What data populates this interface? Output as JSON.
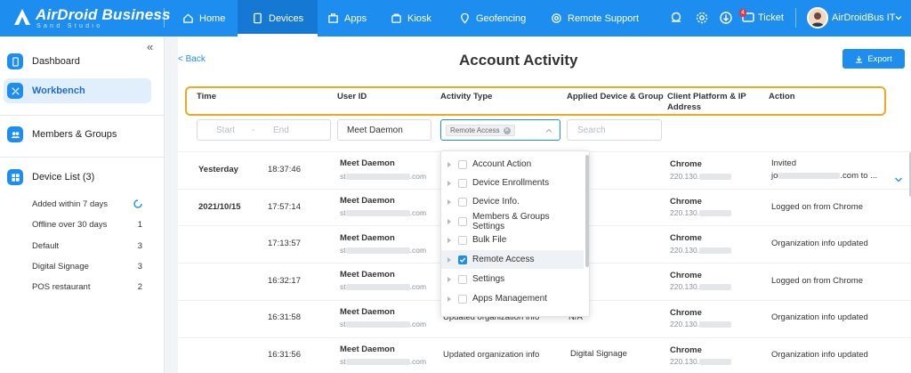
{
  "brand": {
    "name": "AirDroid Business",
    "sub": "Sand Studio"
  },
  "nav": [
    {
      "label": "Home",
      "icon": "home-icon"
    },
    {
      "label": "Devices",
      "icon": "devices-icon",
      "active": true
    },
    {
      "label": "Apps",
      "icon": "apps-icon"
    },
    {
      "label": "Kiosk",
      "icon": "kiosk-icon"
    },
    {
      "label": "Geofencing",
      "icon": "geofencing-icon"
    },
    {
      "label": "Remote Support",
      "icon": "remote-support-icon"
    }
  ],
  "topright": {
    "badge": "4",
    "ticket": "Ticket",
    "user": "AirDroidBus IT"
  },
  "sidebar": {
    "items": [
      {
        "label": "Dashboard",
        "icon": "dashboard-icon"
      },
      {
        "label": "Workbench",
        "icon": "workbench-icon",
        "active": true
      },
      {
        "label": "Members & Groups",
        "icon": "members-icon"
      },
      {
        "label": "Device List (3)",
        "icon": "device-list-icon"
      }
    ],
    "sub": [
      {
        "label": "Added within 7 days",
        "count": ""
      },
      {
        "label": "Offline over 30 days",
        "count": "1"
      },
      {
        "label": "Default",
        "count": "3"
      },
      {
        "label": "Digital Signage",
        "count": "3"
      },
      {
        "label": "POS restaurant",
        "count": "2"
      }
    ]
  },
  "page": {
    "back": "< Back",
    "title": "Account Activity",
    "export": "Export"
  },
  "columns": [
    "Time",
    "User ID",
    "Activity Type",
    "Applied Device & Group",
    "Client Platform & IP Address",
    "Action"
  ],
  "filters": {
    "start": "Start",
    "dash": "-",
    "end": "End",
    "user": "Meet Daemon",
    "activity_tag": "Remote Access",
    "search_placeholder": "Search"
  },
  "rows": [
    {
      "date": "Yesterday",
      "time": "18:37:46",
      "user": "Meet Daemon",
      "email_pre": "st",
      "email_post": ".com",
      "type": "",
      "device": "",
      "platform": "Chrome",
      "ip": "220.130.",
      "action": "Invited",
      "action2_pre": "jo",
      "action2_post": ".com to ..."
    },
    {
      "date": "2021/10/15",
      "time": "17:57:14",
      "user": "Meet Daemon",
      "email_pre": "st",
      "email_post": ".com",
      "type": "",
      "device": "",
      "platform": "Chrome",
      "ip": "220.130.",
      "action": "Logged on from Chrome"
    },
    {
      "date": "",
      "time": "17:13:57",
      "user": "Meet Daemon",
      "email_pre": "st",
      "email_post": ".com",
      "type": "",
      "device": "",
      "platform": "Chrome",
      "ip": "220.130.",
      "action": "Organization info updated"
    },
    {
      "date": "",
      "time": "16:32:17",
      "user": "Meet Daemon",
      "email_pre": "st",
      "email_post": ".com",
      "type": "",
      "device": "",
      "platform": "Chrome",
      "ip": "220.130.",
      "action": "Logged on from Chrome"
    },
    {
      "date": "",
      "time": "16:31:58",
      "user": "Meet Daemon",
      "email_pre": "st",
      "email_post": ".com",
      "type": "Updated organization info",
      "device": "N/A",
      "platform": "Chrome",
      "ip": "220.130.",
      "action": "Organization info updated"
    },
    {
      "date": "",
      "time": "16:31:56",
      "user": "Meet Daemon",
      "email_pre": "st",
      "email_post": ".com",
      "type": "Updated organization info",
      "device": "Digital Signage",
      "platform": "Chrome",
      "ip": "220.130.",
      "action": "Organization info updated"
    }
  ],
  "dropdown": [
    {
      "label": "Account Action",
      "checked": false
    },
    {
      "label": "Device Enrollments",
      "checked": false
    },
    {
      "label": "Device Info.",
      "checked": false
    },
    {
      "label": "Members & Groups Settings",
      "checked": false
    },
    {
      "label": "Bulk File",
      "checked": false
    },
    {
      "label": "Remote Access",
      "checked": true
    },
    {
      "label": "Settings",
      "checked": false
    },
    {
      "label": "Apps Management",
      "checked": false
    }
  ],
  "colors": {
    "brand": "#1d8ef0",
    "highlight_border": "#f0a81e"
  }
}
